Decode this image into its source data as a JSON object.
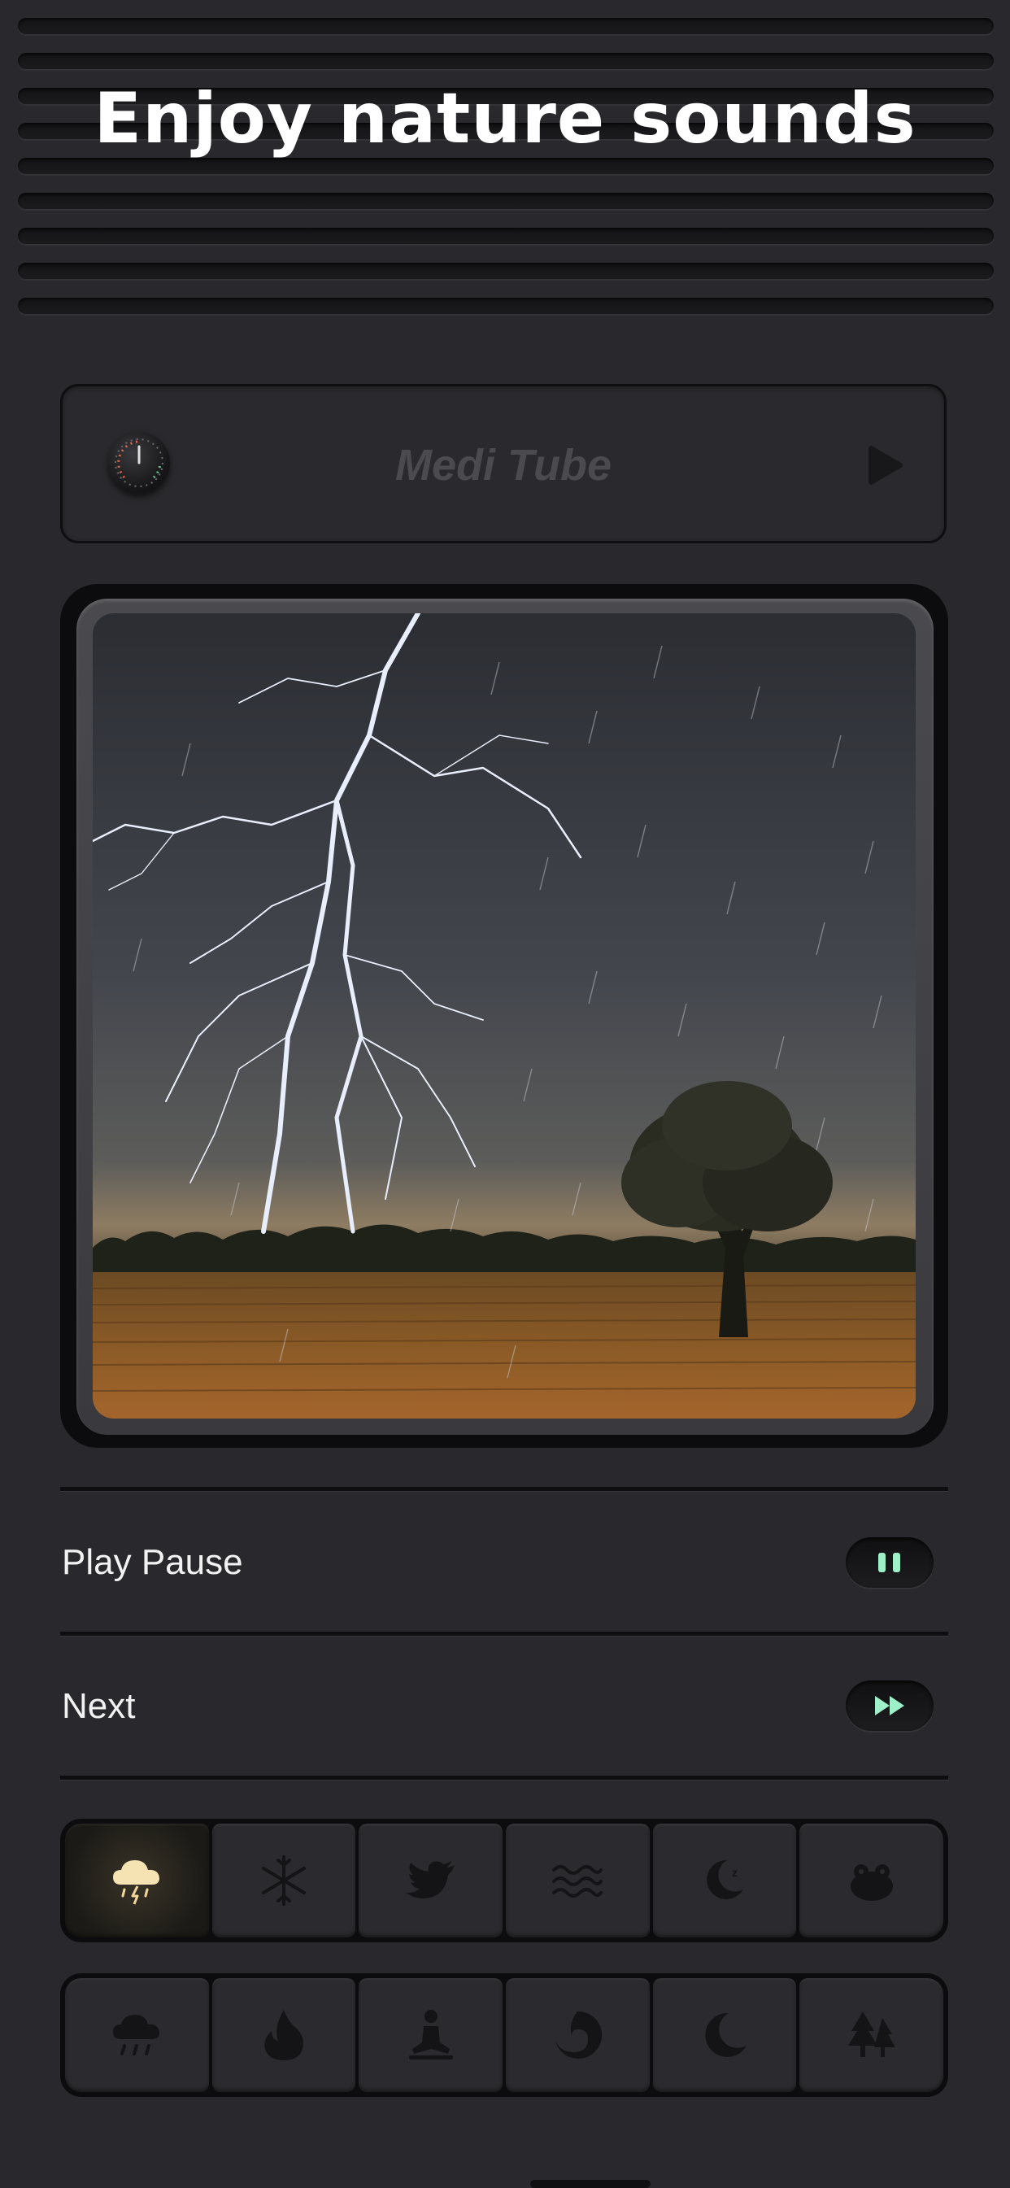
{
  "header": {
    "title": "Enjoy nature sounds"
  },
  "tube": {
    "title": "Medi Tube"
  },
  "controls": [
    {
      "label": "Play Pause",
      "icon": "pause-icon"
    },
    {
      "label": "Next",
      "icon": "fast-forward-icon"
    }
  ],
  "sounds_row1": [
    "thunderstorm-icon",
    "snowflake-icon",
    "bird-icon",
    "waves-icon",
    "moon-zzz-icon",
    "frog-icon"
  ],
  "sounds_row2": [
    "rain-cloud-icon",
    "fire-icon",
    "meditation-icon",
    "swirl-icon",
    "moon-icon",
    "forest-icon"
  ],
  "active_sound": "thunderstorm-icon",
  "colors": {
    "accent": "#9ef0c8",
    "active_glow": "#f3d79a",
    "background": "#29292d"
  }
}
